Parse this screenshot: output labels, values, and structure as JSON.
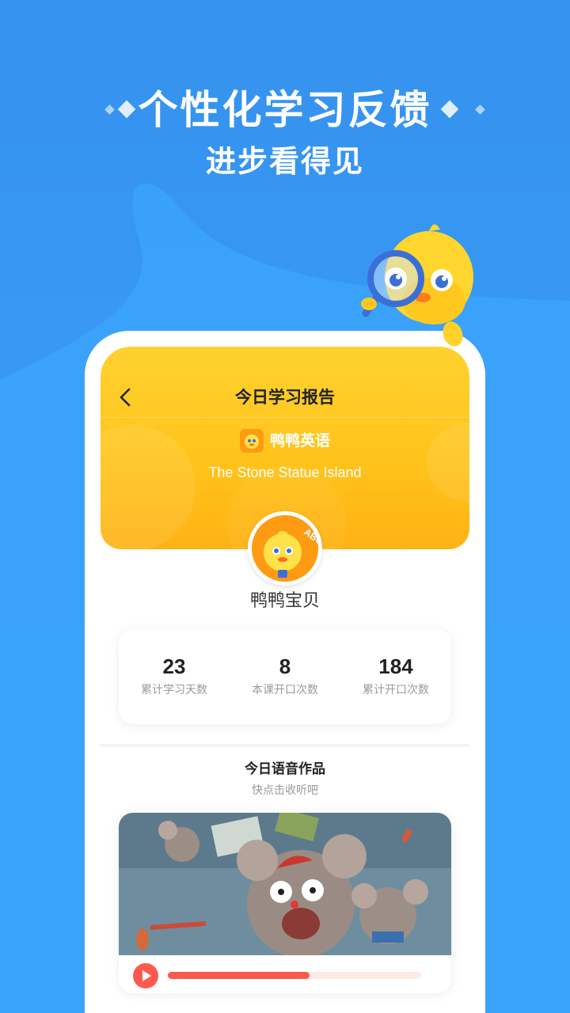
{
  "promo": {
    "title": "个性化学习反馈",
    "subtitle": "进步看得见"
  },
  "report": {
    "nav_title": "今日学习报告",
    "brand_name": "鸭鸭英语",
    "lesson_title": "The Stone Statue Island",
    "user_name": "鸭鸭宝贝",
    "avatar_text": "ABC",
    "stats": [
      {
        "value": "23",
        "label": "累计学习天数"
      },
      {
        "value": "8",
        "label": "本课开口次数"
      },
      {
        "value": "184",
        "label": "累计开口次数"
      }
    ],
    "voice_section": {
      "title": "今日语音作品",
      "subtitle": "快点击收听吧",
      "progress": 0.56
    }
  },
  "icons": {
    "back": "chevron-left-icon",
    "play": "play-icon",
    "brand_logo": "duck-logo-icon",
    "mascot": "duck-magnifier-mascot"
  },
  "colors": {
    "background": "#3592ee",
    "header_yellow": "#ffc21a",
    "accent_red": "#f95a4b",
    "brand_orange": "#ff9b13"
  }
}
